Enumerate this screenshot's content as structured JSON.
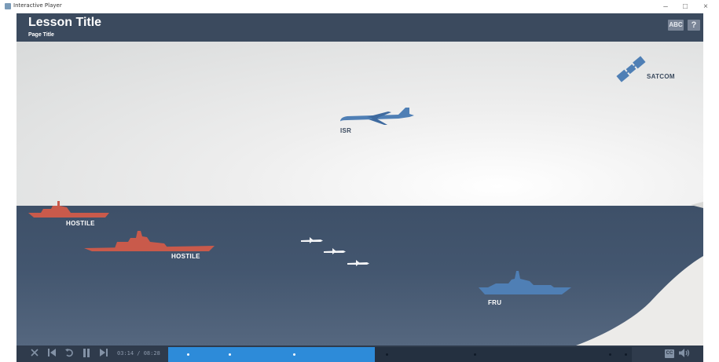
{
  "window": {
    "title": "Interactive Player",
    "minimize": "–",
    "maximize": "□",
    "close": "×"
  },
  "header": {
    "lesson_title": "Lesson Title",
    "page_title": "Page Title",
    "abc_label": "ABC",
    "help_label": "?"
  },
  "scene": {
    "satcom": "SATCOM",
    "isr": "ISR",
    "hostile_1": "HOSTILE",
    "hostile_2": "HOSTILE",
    "fru": "FRU"
  },
  "player": {
    "time": "03:14 / 08:28",
    "progress": 0.445,
    "markers": [
      0.04,
      0.13,
      0.27,
      0.47,
      0.66,
      0.95,
      0.985
    ],
    "icons": [
      "close-icon",
      "skip-back-icon",
      "replay-icon",
      "pause-icon",
      "skip-forward-icon",
      "captions-icon",
      "volume-icon"
    ],
    "cc_label": "CC"
  },
  "colors": {
    "header": "#3b4a5e",
    "sea": "#43566f",
    "hostile": "#c95a4b",
    "friendly": "#4f7fb5",
    "progress": "#2d8bd9"
  }
}
